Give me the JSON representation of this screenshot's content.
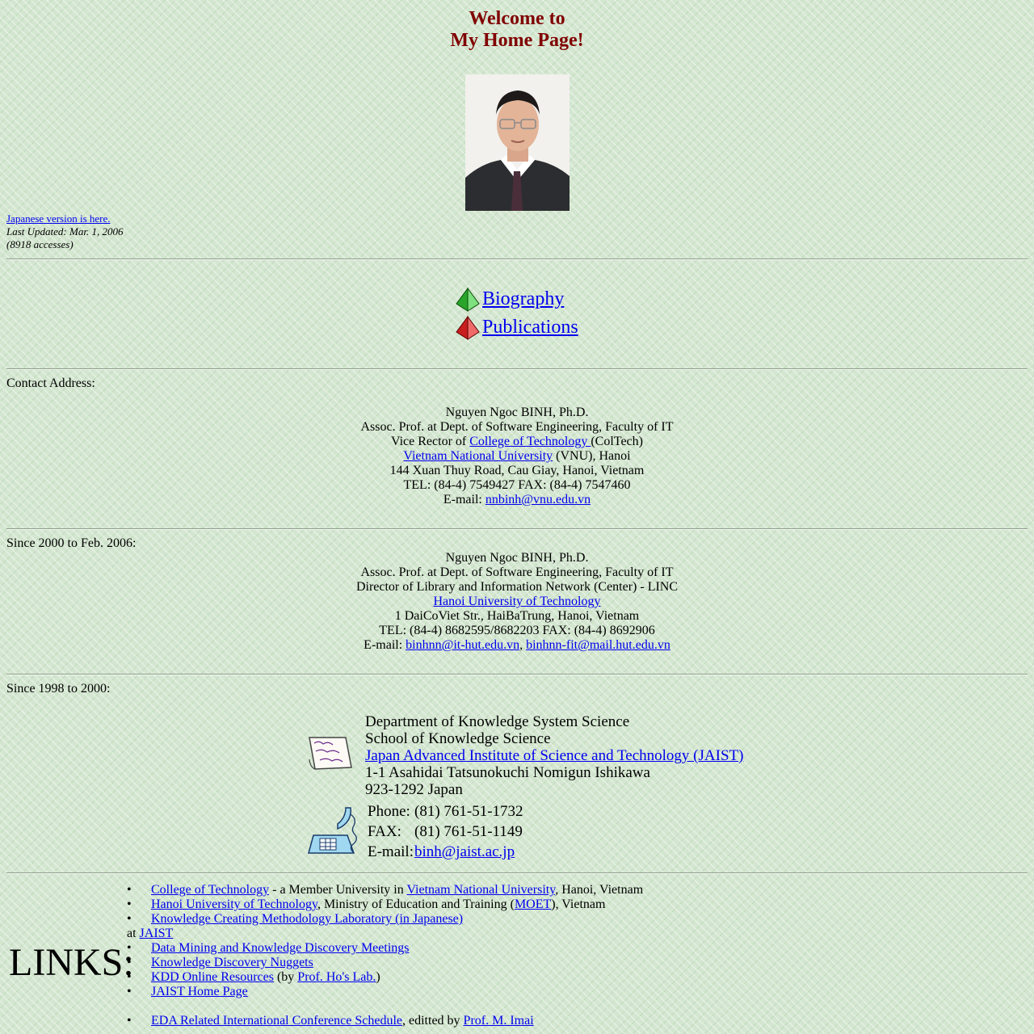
{
  "header": {
    "welcome_line1": "Welcome to",
    "welcome_line2": "My Home Page!"
  },
  "meta": {
    "japanese_link": "Japanese version is here.",
    "last_updated": "Last Updated: Mar. 1, 2006",
    "accesses": "(8918 accesses)"
  },
  "nav": {
    "biography": "Biography",
    "publications": "Publications"
  },
  "contact": {
    "heading": "Contact Address:",
    "name": "Nguyen Ngoc BINH, Ph.D.",
    "position": "Assoc. Prof. at Dept. of Software Engineering, Faculty of IT",
    "vice_prefix": "Vice Rector of ",
    "college_link": "College of Technology ",
    "college_suffix": "(ColTech)",
    "vnu_link": "Vietnam National University",
    "vnu_suffix": " (VNU), Hanoi",
    "address": "144 Xuan Thuy Road, Cau Giay, Hanoi, Vietnam",
    "tel": "TEL: (84-4) 7549427 FAX: (84-4) 7547460",
    "email_label": "E-mail: ",
    "email": "nnbinh@vnu.edu.vn"
  },
  "period2000": {
    "heading": "Since 2000 to Feb. 2006:",
    "name": "Nguyen Ngoc BINH, Ph.D.",
    "position": "Assoc. Prof. at Dept. of Software Engineering, Faculty of IT",
    "director": "Director of Library and Information Network (Center) - LINC",
    "hut_link": "Hanoi University of Technology",
    "address": "1 DaiCoViet Str., HaiBaTrung, Hanoi, Vietnam",
    "tel": "TEL: (84-4) 8682595/8682203 FAX: (84-4) 8692906",
    "email_label": "E-mail: ",
    "email1": "binhnn@it-hut.edu.vn",
    "sep": ", ",
    "email2": "binhnn-fit@mail.hut.edu.vn"
  },
  "period1998": {
    "heading": "Since 1998 to 2000:",
    "dept": "Department of Knowledge System Science",
    "school": "School of Knowledge Science",
    "jaist_link": "Japan Advanced Institute of Science and Technology (JAIST)",
    "address1": "1-1 Asahidai Tatsunokuchi Nomigun Ishikawa",
    "address2": "923-1292 Japan",
    "phone_label": "Phone:",
    "phone": "(81) 761-51-1732",
    "fax_label": "FAX:",
    "fax": "(81) 761-51-1149",
    "email_label": "E-mail:",
    "email": "binh@jaist.ac.jp"
  },
  "links": {
    "title": "LINKS:",
    "bullet": "•",
    "l1_a": "College of Technology",
    "l1_b": " - a Member University in ",
    "l1_c": "Vietnam National University",
    "l1_d": ", Hanoi, Vietnam",
    "l2_a": "Hanoi University of Technology",
    "l2_b": ", Ministry of Education and Training (",
    "l2_c": "MOET",
    "l2_d": "), Vietnam",
    "l3_a": "Knowledge Creating Methodology Laboratory (in Japanese)",
    "l3_at": "at ",
    "l3_b": "JAIST",
    "l4": "Data Mining and Knowledge Discovery Meetings",
    "l5": "Knowledge Discovery Nuggets",
    "l6_a": "KDD Online Resources",
    "l6_b": " (by ",
    "l6_c": "Prof. Ho's Lab.",
    "l6_d": ")",
    "l7": "JAIST Home Page",
    "l8_a": "EDA Related International Conference Schedule",
    "l8_b": ", editted by ",
    "l8_c": "Prof. M. Imai"
  }
}
